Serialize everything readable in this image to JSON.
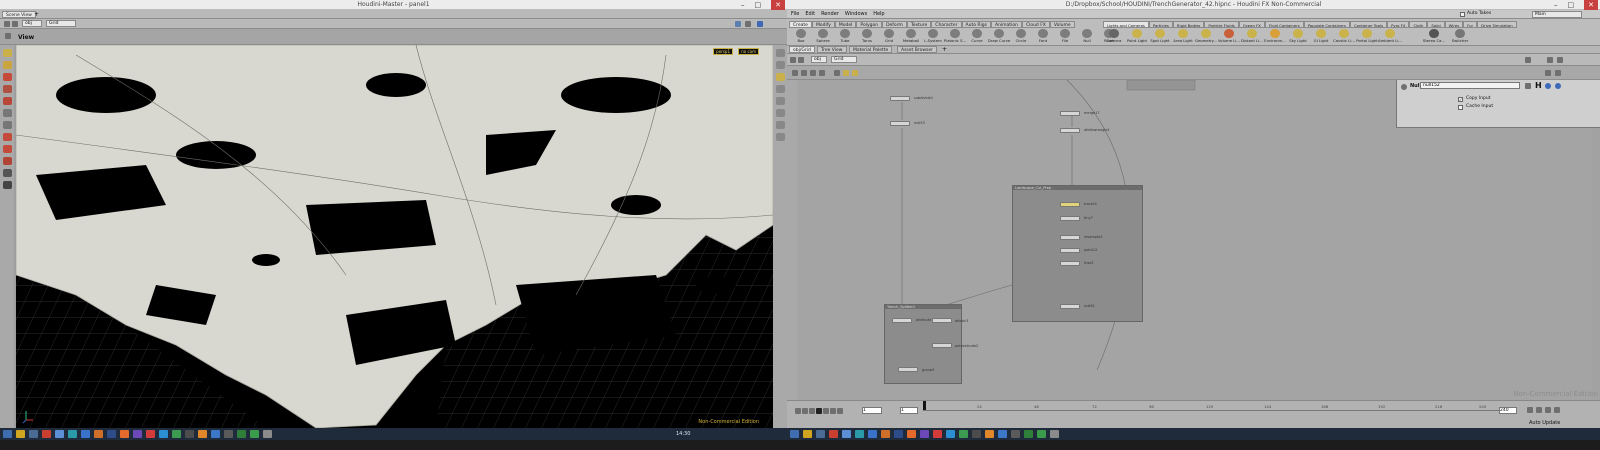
{
  "left_window": {
    "title": "Houdini-Master - panel1",
    "pane_tab": "Scene View",
    "path": {
      "context": "obj",
      "node": "Grid"
    },
    "view_label": "View",
    "camera_menu": "persp1",
    "display_menu": "no cam",
    "watermark": "Non-Commercial Edition"
  },
  "right_window": {
    "title": "D:/Dropbox/School/HOUDINI/TrenchGenerator_42.hipnc - Houdini FX Non-Commercial",
    "menus": [
      "File",
      "Edit",
      "Render",
      "Windows",
      "Help"
    ],
    "auto_takes": "Auto Takes",
    "desktop": "Main",
    "shelf_tabs_left": [
      "Create",
      "Modify",
      "Model",
      "Polygon",
      "Deform",
      "Texture",
      "Character",
      "Auto Rigs",
      "Animation",
      "Cloud FX",
      "Volume"
    ],
    "shelf_tabs_right": [
      "Lights and Cameras",
      "Particles",
      "Rigid Bodies",
      "Particle Fluids",
      "Ocean FX",
      "Fluid Containers",
      "Populate Containers",
      "Container Tools",
      "Pyro FX",
      "Cloth",
      "Solid",
      "Wires",
      "Fur",
      "Drive Simulation"
    ],
    "shelf_tools_left": [
      "Box",
      "Sphere",
      "Tube",
      "Torus",
      "Grid",
      "Metaball",
      "L-System",
      "Platonic S...",
      "Curve",
      "Draw Curve",
      "Circle",
      "Font",
      "File",
      "Null",
      "Rivet"
    ],
    "shelf_tools_right": [
      "Camera",
      "Point Light",
      "Spot Light",
      "Area Light",
      "Geometry...",
      "Volume Li...",
      "Distant Li...",
      "Environm...",
      "Sky Light",
      "GI Light",
      "Caustic Li...",
      "Portal Light",
      "Ambient Li...",
      "Stereo Ca...",
      "Switcher"
    ],
    "pane_tabs": [
      "obj/Grid",
      "Tree View",
      "Material Palette",
      "Asset Browser"
    ],
    "path": {
      "context": "obj",
      "node": "Grid"
    },
    "param": {
      "node_type": "Null",
      "node_name": "null152",
      "copy_input": "Copy Input",
      "cache_input": "Cache Input",
      "copy_input_checked": true,
      "cache_input_checked": false
    },
    "network": {
      "nodes": [
        {
          "id": "n1",
          "label": "subdivide1"
        },
        {
          "id": "n2",
          "label": "null53"
        },
        {
          "id": "n3",
          "label": "merge17"
        },
        {
          "id": "n4",
          "label": "attribwrangle1"
        },
        {
          "id": "n5",
          "label": "tracer4"
        },
        {
          "id": "n6",
          "label": "tiny7"
        },
        {
          "id": "n7",
          "label": "resample3"
        },
        {
          "id": "n8",
          "label": "point12"
        },
        {
          "id": "n9",
          "label": "fuse2"
        },
        {
          "id": "n10",
          "label": "null61"
        },
        {
          "id": "n11",
          "label": "attribute"
        },
        {
          "id": "n12",
          "label": "attrstr3"
        },
        {
          "id": "n13",
          "label": "polyextrude2"
        },
        {
          "id": "n14",
          "label": "group9"
        }
      ],
      "boxes": [
        {
          "id": "b1",
          "label": "Landscape_Cut_Prep"
        },
        {
          "id": "b2",
          "label": "Trench_Splitter2"
        }
      ]
    },
    "timeline": {
      "ticks": [
        "1",
        "24",
        "48",
        "72",
        "96",
        "120",
        "144",
        "168",
        "192",
        "216",
        "240"
      ],
      "start_frame": "1",
      "current_frame": "1",
      "end_frame": "240",
      "auto_update": "Auto Update",
      "watermark": "Non-Commercial Edition"
    }
  },
  "taskbar": {
    "clock": "14:30"
  }
}
